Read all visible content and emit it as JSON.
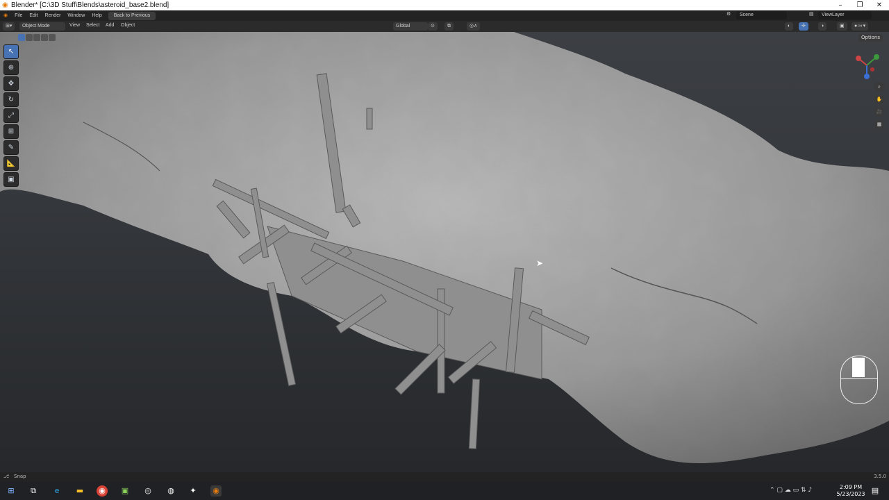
{
  "window": {
    "title": "Blender* [C:\\3D Stuff\\Blends\\asteroid_base2.blend]",
    "minimize": "–",
    "restore": "❐",
    "close": "✕"
  },
  "menu": {
    "items": [
      "File",
      "Edit",
      "Render",
      "Window",
      "Help"
    ],
    "back_button": "Back to Previous",
    "scene_label": "Scene",
    "viewlayer_label": "ViewLayer"
  },
  "header": {
    "mode": "Object Mode",
    "items": [
      "View",
      "Select",
      "Add",
      "Object"
    ],
    "transform_orientation": "Global",
    "options": "Options"
  },
  "toolbar": {
    "tools": [
      "select-box",
      "cursor",
      "move",
      "rotate",
      "scale",
      "transform",
      "annotate",
      "measure",
      "add-cube"
    ]
  },
  "status": {
    "left_hint": "Snap",
    "version": "3.5.0"
  },
  "taskbar": {
    "time": "2:09 PM",
    "date": "5/23/2023"
  },
  "colors": {
    "accent": "#4772b3",
    "background": "#3a3d41"
  }
}
